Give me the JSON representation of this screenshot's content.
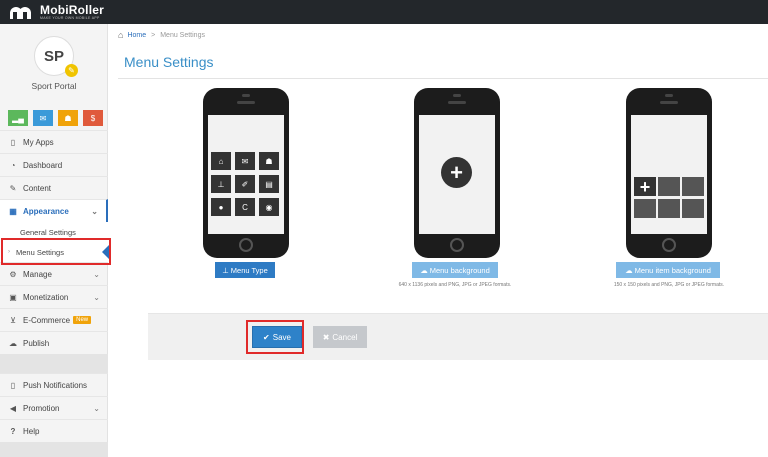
{
  "brand": {
    "name": "MobiRoller",
    "tagline": "MAKE YOUR OWN MOBILE APP"
  },
  "profile": {
    "initials": "SP",
    "app_name": "Sport Portal"
  },
  "quick_actions": [
    {
      "icon": "stats-icon",
      "color": "#5cb85c",
      "glyph": "▂▄"
    },
    {
      "icon": "mail-icon",
      "color": "#3b9ad9",
      "glyph": "✉"
    },
    {
      "icon": "users-icon",
      "color": "#f0a30a",
      "glyph": "☗"
    },
    {
      "icon": "dollar-icon",
      "color": "#e05a3c",
      "glyph": "$"
    }
  ],
  "sidebar": {
    "my_apps": "My Apps",
    "dashboard": "Dashboard",
    "content": "Content",
    "appearance": "Appearance",
    "general_settings": "General Settings",
    "menu_settings": "Menu Settings",
    "manage": "Manage",
    "monetization": "Monetization",
    "ecommerce": "E-Commerce",
    "ecommerce_badge": "New",
    "publish": "Publish",
    "push": "Push Notifications",
    "promotion": "Promotion",
    "help": "Help"
  },
  "breadcrumb": {
    "home": "Home",
    "separator": ">",
    "current": "Menu Settings"
  },
  "page_title": "Menu Settings",
  "options": {
    "menu_type": {
      "button": "Menu Type",
      "color": "#2e7bc4"
    },
    "menu_background": {
      "button": "Menu background",
      "note": "640 x 1136 pixels and PNG, JPG or JPEG formats.",
      "color": "#7fb9e6"
    },
    "menu_item_background": {
      "button": "Menu item background",
      "note": "150 x 150 pixels and PNG, JPG or JPEG formats.",
      "color": "#7fb9e6"
    }
  },
  "actions": {
    "save": "Save",
    "cancel": "Cancel"
  }
}
